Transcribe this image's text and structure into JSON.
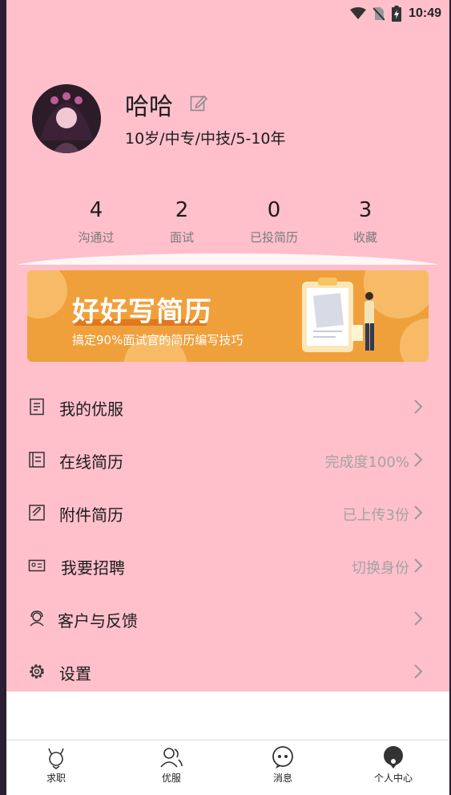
{
  "status_bar": {
    "time": "10:49"
  },
  "profile": {
    "name": "哈哈",
    "info": "10岁/中专/中技/5-10年"
  },
  "stats": [
    {
      "value": "4",
      "label": "沟通过"
    },
    {
      "value": "2",
      "label": "面试"
    },
    {
      "value": "0",
      "label": "已投简历"
    },
    {
      "value": "3",
      "label": "收藏"
    }
  ],
  "banner": {
    "title": "好好写简历",
    "subtitle": "搞定90%面试官的简历编写技巧"
  },
  "menu": [
    {
      "label": "我的优服",
      "value": "",
      "icon": "document-icon"
    },
    {
      "label": "在线简历",
      "value": "完成度100%",
      "icon": "resume-icon"
    },
    {
      "label": "附件简历",
      "value": "已上传3份",
      "icon": "attachment-icon"
    },
    {
      "label": "我要招聘",
      "value": "切换身份",
      "icon": "id-card-icon"
    },
    {
      "label": "客户与反馈",
      "value": "",
      "icon": "headset-icon"
    },
    {
      "label": "设置",
      "value": "",
      "icon": "gear-icon"
    }
  ],
  "tabs": [
    {
      "label": "求职",
      "icon": "job-search-icon"
    },
    {
      "label": "优服",
      "icon": "people-icon"
    },
    {
      "label": "消息",
      "icon": "message-icon"
    },
    {
      "label": "个人中心",
      "icon": "profile-icon"
    }
  ]
}
